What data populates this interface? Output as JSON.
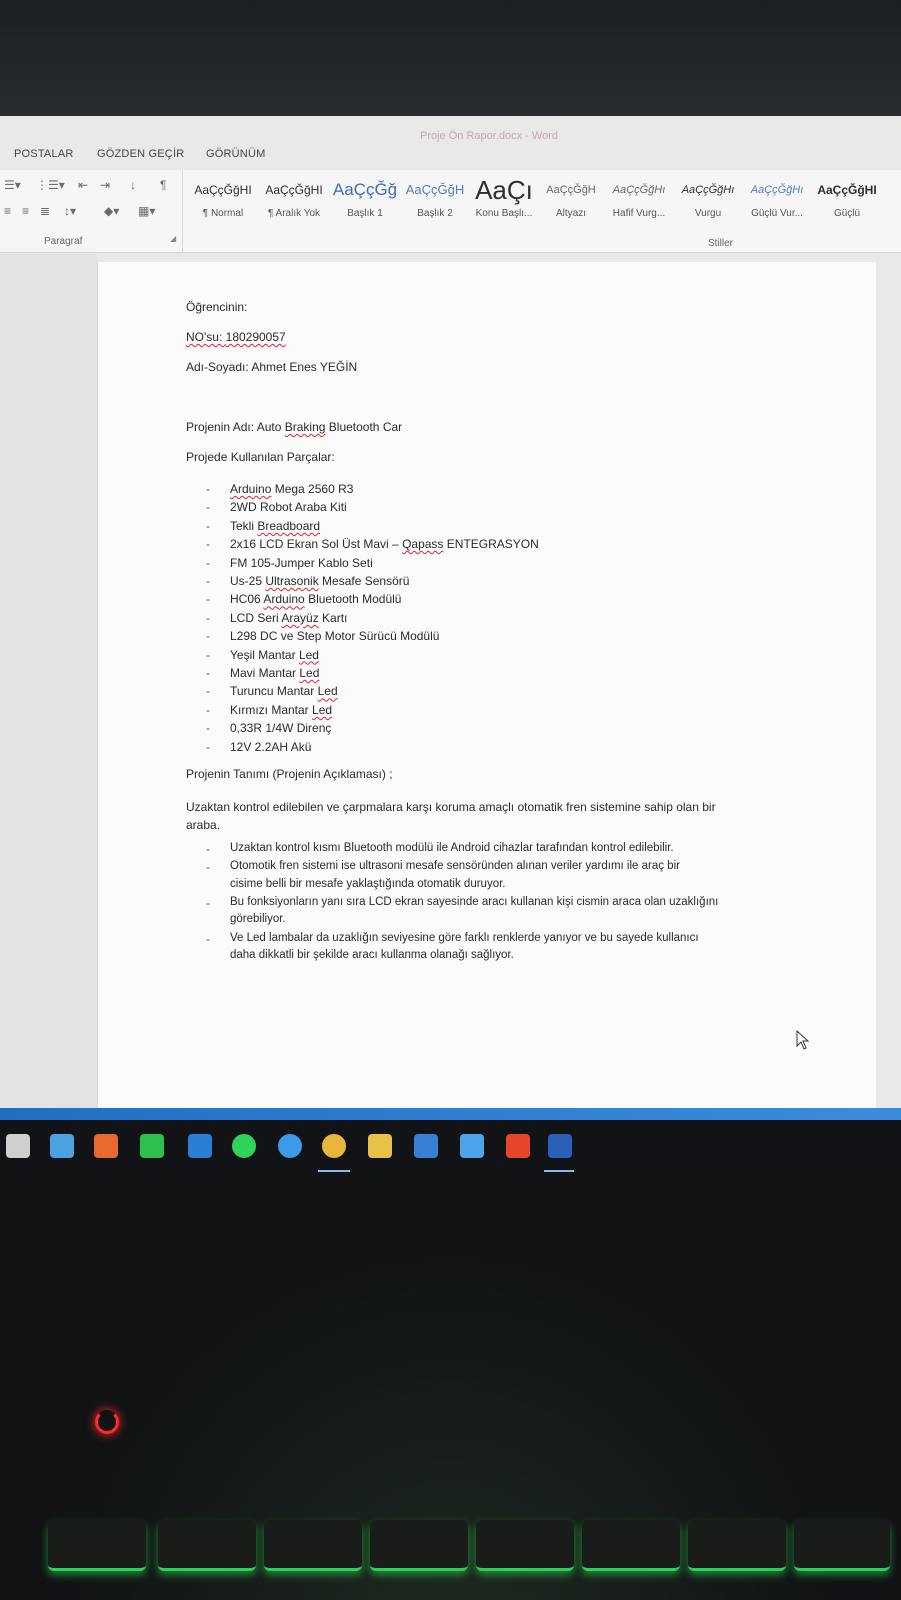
{
  "window": {
    "title": "Proje Ön Rapor.docx - Word"
  },
  "ribbon": {
    "tabs": [
      "POSTALAR",
      "GÖZDEN GEÇİR",
      "GÖRÜNÜM"
    ],
    "paragraph_group_label": "Paragraf",
    "styles_group_label": "Stiller",
    "styles": [
      {
        "sample": "AaÇçĞğHI",
        "name": "¶ Normal"
      },
      {
        "sample": "AaÇçĞğHI",
        "name": "¶ Aralık Yok"
      },
      {
        "sample": "AaÇçĞğ",
        "name": "Başlık 1"
      },
      {
        "sample": "AaÇçĞğH",
        "name": "Başlık 2"
      },
      {
        "sample": "AaÇı",
        "name": "Konu Başlı..."
      },
      {
        "sample": "AaÇçĞğH",
        "name": "Altyazı"
      },
      {
        "sample": "AaÇçĞğHı",
        "name": "Hafif Vurg..."
      },
      {
        "sample": "AaÇçĞğHı",
        "name": "Vurgu"
      },
      {
        "sample": "AaÇçĞğHı",
        "name": "Güçlü Vur..."
      },
      {
        "sample": "AaÇçĞğHI",
        "name": "Güçlü"
      }
    ]
  },
  "document": {
    "student_heading": "Öğrencinin:",
    "student_no_label": "NO'su: ",
    "student_no_value": "180290057",
    "name_label": "Adı-Soyadı: ",
    "name_value": "Ahmet Enes YEĞİN",
    "project_name_label": "Projenin Adı: ",
    "project_name_value_1": "Auto ",
    "project_name_value_2": "Braking",
    "project_name_value_3": " Bluetooth Car",
    "parts_heading": "Projede Kullanılan Parçalar:",
    "parts": [
      {
        "pre": "",
        "err": "Arduino",
        "post": " Mega 2560 R3"
      },
      {
        "pre": "2WD Robot Araba Kiti",
        "err": "",
        "post": ""
      },
      {
        "pre": "Tekli ",
        "err": "Breadboard",
        "post": ""
      },
      {
        "pre": "2x16 LCD Ekran Sol Üst Mavi – ",
        "err": "Qapass",
        "post": " ENTEGRASYON"
      },
      {
        "pre": "FM 105-Jumper Kablo Seti",
        "err": "",
        "post": ""
      },
      {
        "pre": "Us-25 ",
        "err": "Ultrasonik",
        "post": " Mesafe Sensörü"
      },
      {
        "pre": "HC06 ",
        "err": "Arduino",
        "post": " Bluetooth Modülü"
      },
      {
        "pre": "LCD Seri ",
        "err": "Arayüz",
        "post": " Kartı"
      },
      {
        "pre": "L298 DC ve Step Motor Sürücü Modülü",
        "err": "",
        "post": ""
      },
      {
        "pre": "Yeşil Mantar ",
        "err": "Led",
        "post": ""
      },
      {
        "pre": "Mavi Mantar ",
        "err": "Led",
        "post": ""
      },
      {
        "pre": "Turuncu Mantar ",
        "err": "Led",
        "post": ""
      },
      {
        "pre": "Kırmızı Mantar ",
        "err": "Led",
        "post": ""
      },
      {
        "pre": "0,33R 1/4W Direnç",
        "err": "",
        "post": ""
      },
      {
        "pre": "12V 2.2AH Akü",
        "err": "",
        "post": ""
      }
    ],
    "description_heading": "Projenin Tanımı (Projenin Açıklaması) ;",
    "description_line_1": "Uzaktan kontrol edilebilen ve çarpmalara karşı koruma amaçlı otomatik fren sistemine sahip olan bir",
    "description_line_2": "araba.",
    "bullets": [
      "Uzaktan kontrol kısmı Bluetooth modülü ile Android cihazlar tarafından kontrol edilebilir.",
      "Otomotik fren sistemi ise ultrasoni mesafe sensöründen alınan veriler yardımı ile araç bir",
      "cisime belli bir mesafe yaklaştığında otomatik duruyor.",
      "Bu fonksiyonların yanı sıra LCD ekran sayesinde aracı kullanan kişi cismin araca olan uzaklığını",
      "görebiliyor.",
      "Ve Led lambalar da uzaklığın seviyesine göre farklı renklerde yanıyor ve bu sayede kullanıcı",
      "daha dikkatli bir şekilde aracı kullanma olanağı sağlıyor."
    ]
  },
  "taskbar": {
    "icons": [
      "task-view-icon",
      "edge-legacy-icon",
      "app-orange-icon",
      "pycharm-icon",
      "store-blue-icon",
      "whatsapp-icon",
      "edge-icon",
      "chrome-icon",
      "file-explorer-icon",
      "microsoft-store-icon",
      "mail-icon",
      "office-icon",
      "word-icon"
    ]
  },
  "colors": {
    "accent": "#2d7fd3",
    "spell_error": "#d22233",
    "keyboard_glow": "#2fcf59"
  }
}
